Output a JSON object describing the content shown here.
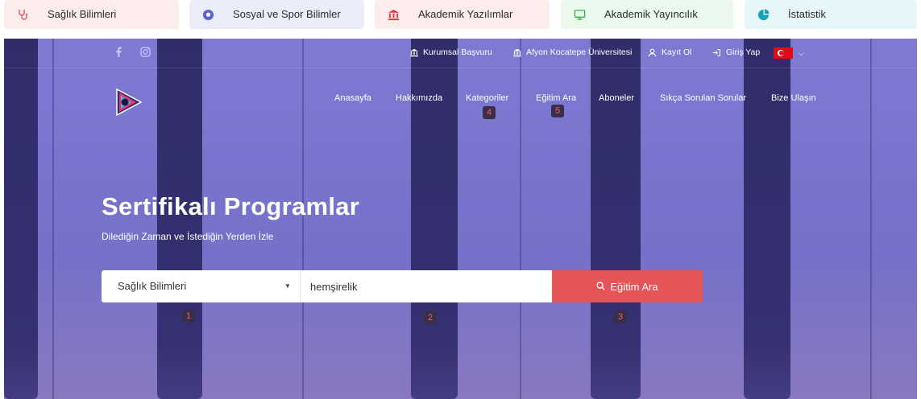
{
  "categories": [
    {
      "label": "Sağlık Bilimleri",
      "icon": "stethoscope-icon",
      "color": "#e8585a"
    },
    {
      "label": "Sosyal ve Spor Bilimler",
      "icon": "soccer-ball-icon",
      "color": "#5b5fd6"
    },
    {
      "label": "Akademik Yazılımlar",
      "icon": "institution-icon",
      "color": "#d9393b"
    },
    {
      "label": "Akademik Yayıncılık",
      "icon": "monitor-icon",
      "color": "#37b24d"
    },
    {
      "label": "İstatistik",
      "icon": "pie-chart-icon",
      "color": "#17a2b8"
    }
  ],
  "topbar": {
    "social": [
      "facebook-icon",
      "instagram-icon"
    ],
    "links": [
      {
        "label": "Kurumsal Başvuru",
        "icon": "institution-icon"
      },
      {
        "label": "Afyon Kocatepe Üniversitesi",
        "icon": "institution-icon"
      },
      {
        "label": "Kayıt Ol",
        "icon": "user-icon"
      },
      {
        "label": "Giriş Yap",
        "icon": "login-icon"
      }
    ],
    "language": "tr"
  },
  "nav": {
    "items": [
      "Anasayfa",
      "Hakkımızda",
      "Kategoriler",
      "Eğitim Ara",
      "Aboneler",
      "Sıkça Sorulan Sorular",
      "Bize Ulaşın"
    ]
  },
  "hero": {
    "title": "Sertifikalı Programlar",
    "subtitle": "Dilediğin Zaman ve İstediğin Yerden İzle"
  },
  "search": {
    "category_value": "Sağlık Bilimleri",
    "query_value": "hemşirelik",
    "button_label": "Eğitim Ara"
  },
  "badges": [
    "1",
    "2",
    "3",
    "4",
    "5"
  ],
  "colors": {
    "accent": "#e55456",
    "hero_overlay": "#5f58d2"
  }
}
